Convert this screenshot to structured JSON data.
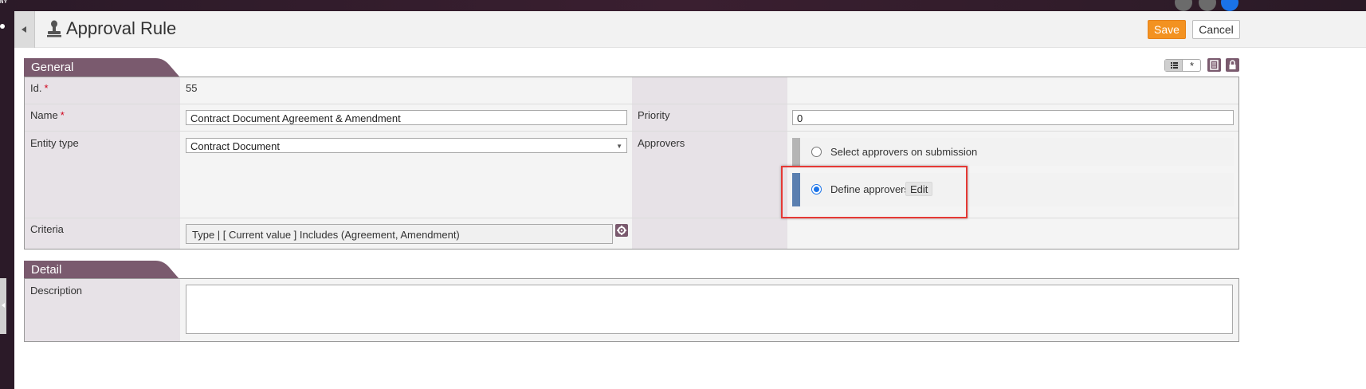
{
  "topbar": {
    "brand_text": "NY"
  },
  "header": {
    "title": "Approval Rule",
    "title_icon": "stamp-icon",
    "save_label": "Save",
    "cancel_label": "Cancel"
  },
  "colors": {
    "accent": "#f39221",
    "section": "#7a5a6e",
    "label_bg": "#e7e2e7",
    "radio_selected": "#1a73e8",
    "highlight": "#e53935"
  },
  "toolbar": {
    "view_toggle_icons": [
      "list-icon",
      "asterisk-icon"
    ],
    "asterisk": "*",
    "icons": [
      "notes-icon",
      "lock-icon"
    ]
  },
  "general": {
    "section_title": "General",
    "id": {
      "label": "Id.",
      "required_mark": "*",
      "value": "55"
    },
    "name": {
      "label": "Name",
      "required_mark": "*",
      "value": "Contract Document Agreement & Amendment"
    },
    "priority": {
      "label": "Priority",
      "value": "0"
    },
    "entity_type": {
      "label": "Entity type",
      "value": "Contract Document"
    },
    "approvers": {
      "label": "Approvers",
      "options": [
        {
          "label": "Select approvers on submission",
          "selected": false
        },
        {
          "label": "Define approvers",
          "selected": true,
          "action_label": "Edit"
        }
      ]
    },
    "criteria": {
      "label": "Criteria",
      "value": "Type | [ Current value ] Includes (Agreement, Amendment)"
    }
  },
  "detail": {
    "section_title": "Detail",
    "description": {
      "label": "Description",
      "value": ""
    }
  }
}
